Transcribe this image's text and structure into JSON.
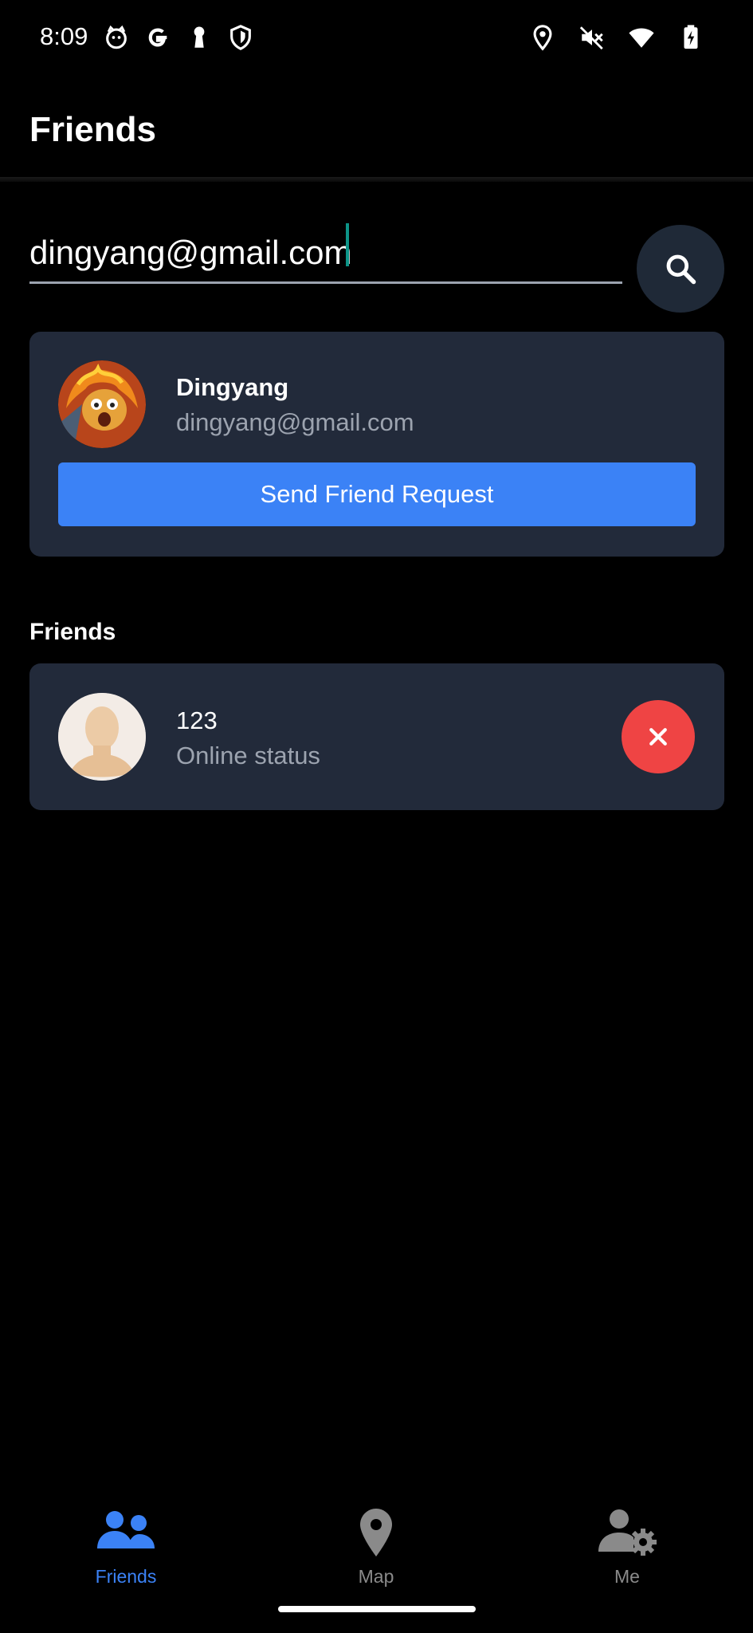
{
  "status_bar": {
    "time": "8:09",
    "left_icons": [
      "cat-face-icon",
      "google-g-icon",
      "keyhole-icon",
      "shield-icon"
    ],
    "right_icons": [
      "location-pin-icon",
      "mute-icon",
      "wifi-icon",
      "battery-charging-icon"
    ]
  },
  "header": {
    "title": "Friends"
  },
  "search": {
    "value": "dingyang@gmail.com",
    "button_icon": "search-icon"
  },
  "search_result": {
    "name": "Dingyang",
    "email": "dingyang@gmail.com",
    "action_label": "Send Friend Request"
  },
  "friends_section": {
    "title": "Friends",
    "items": [
      {
        "name": "123",
        "status": "Online status"
      }
    ]
  },
  "bottom_nav": {
    "items": [
      {
        "label": "Friends",
        "icon": "friends-icon",
        "active": true
      },
      {
        "label": "Map",
        "icon": "map-pin-icon",
        "active": false
      },
      {
        "label": "Me",
        "icon": "user-settings-icon",
        "active": false
      }
    ],
    "active_color": "#3b82f6",
    "inactive_color": "#8a8a8a"
  },
  "colors": {
    "background": "#000000",
    "card": "#222a3a",
    "primary": "#3b82f6",
    "danger": "#ef4444",
    "muted_text": "#9ca3af"
  }
}
